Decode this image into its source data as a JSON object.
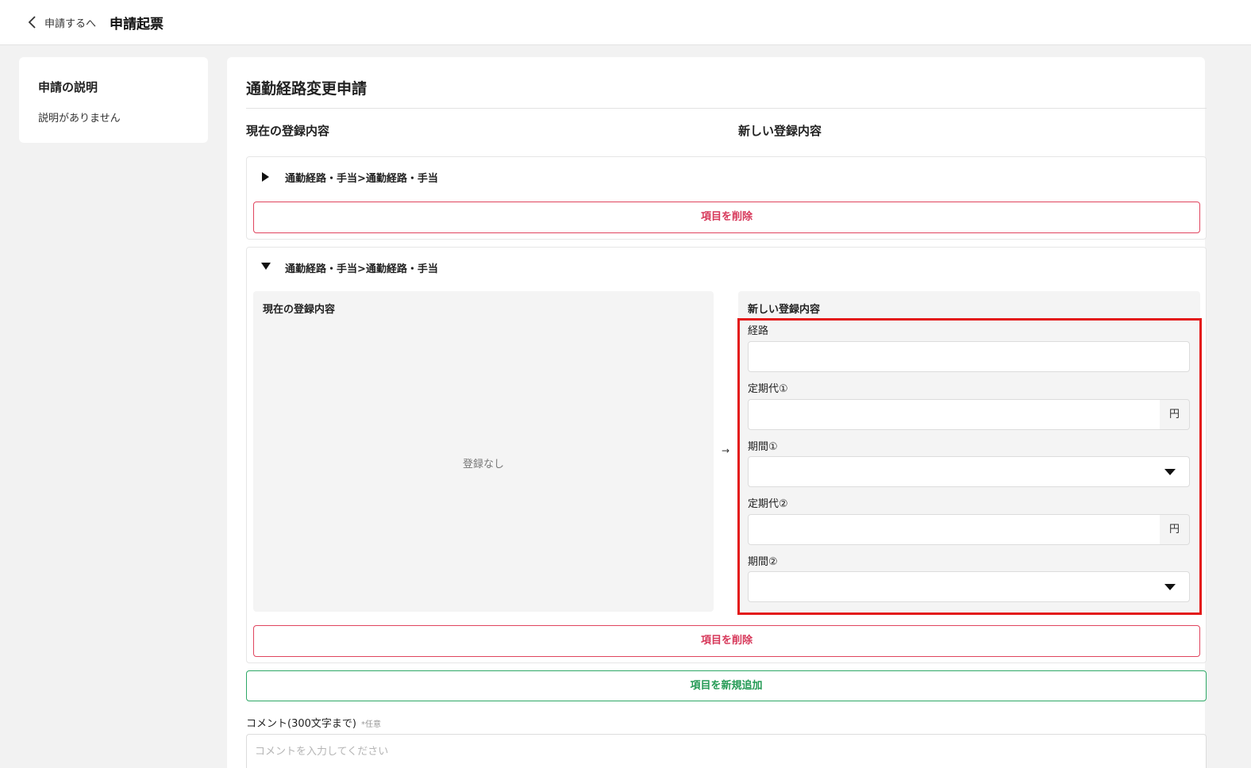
{
  "header": {
    "back_label": "申請するへ",
    "title": "申請起票"
  },
  "description": {
    "title": "申請の説明",
    "body": "説明がありません"
  },
  "form": {
    "title": "通勤経路変更申請",
    "current_heading": "現在の登録内容",
    "new_heading": "新しい登録内容",
    "sections": [
      {
        "title": "通勤経路・手当>通勤経路・手当",
        "expanded": false,
        "delete_label": "項目を削除"
      },
      {
        "title": "通勤経路・手当>通勤経路・手当",
        "expanded": true,
        "current_label": "現在の登録内容",
        "current_empty": "登録なし",
        "arrow": "→",
        "new_label": "新しい登録内容",
        "fields": {
          "route_label": "経路",
          "route_value": "",
          "pass1_label": "定期代①",
          "pass1_value": "",
          "pass1_unit": "円",
          "period1_label": "期間①",
          "period1_value": "",
          "pass2_label": "定期代②",
          "pass2_value": "",
          "pass2_unit": "円",
          "period2_label": "期間②",
          "period2_value": ""
        },
        "delete_label": "項目を削除"
      }
    ],
    "add_label": "項目を新規追加",
    "comment_label": "コメント(300文字まで)",
    "comment_optional": "*任意",
    "comment_placeholder": "コメントを入力してください"
  },
  "colors": {
    "delete": "#d7385a",
    "add": "#249a55",
    "highlight": "#e31919"
  }
}
